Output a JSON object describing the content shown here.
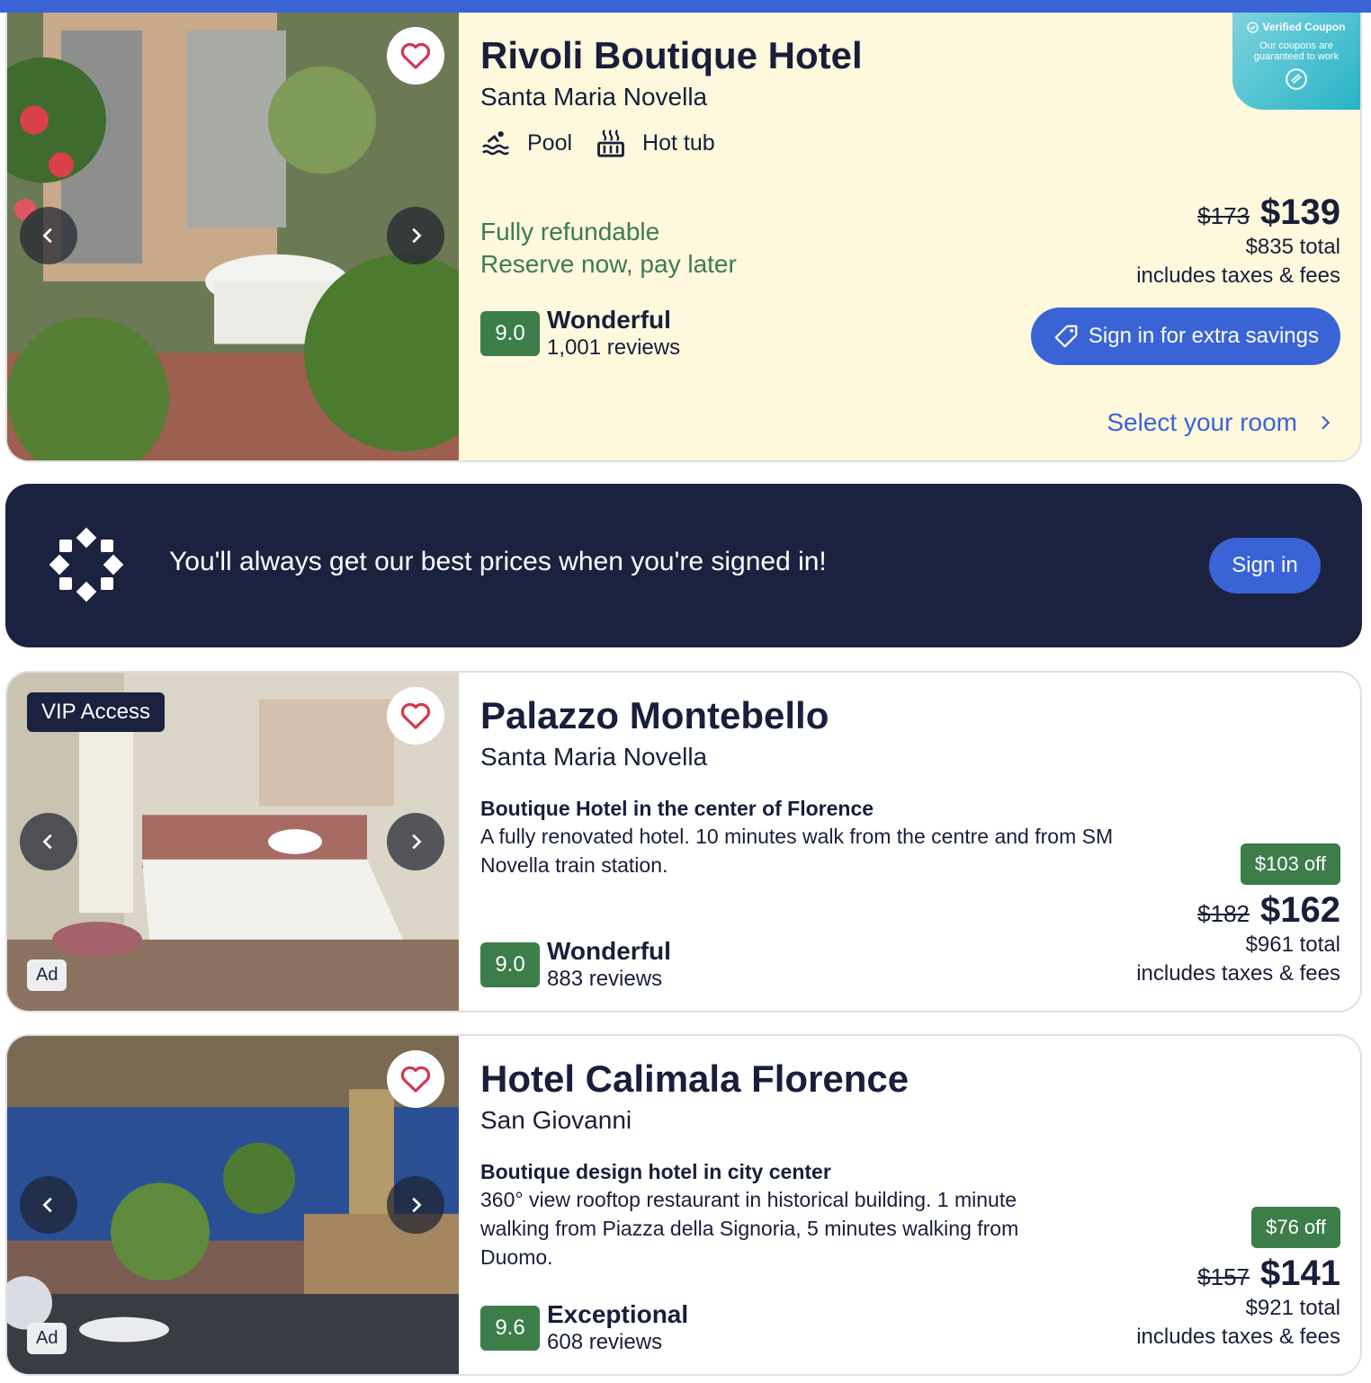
{
  "coupon": {
    "title": "Verified Coupon",
    "text": "Our coupons are guaranteed to work"
  },
  "banner": {
    "text": "You'll always get our best prices when you're signed in!",
    "button": "Sign in"
  },
  "hotels": [
    {
      "name": "Rivoli Boutique Hotel",
      "neighborhood": "Santa Maria Novella",
      "amenities": [
        "Pool",
        "Hot tub"
      ],
      "refundable": "Fully refundable",
      "pay_later": "Reserve now, pay later",
      "score": "9.0",
      "rating_label": "Wonderful",
      "reviews": "1,001 reviews",
      "old_price": "$173",
      "price": "$139",
      "total": "$835 total",
      "taxes": "includes taxes & fees",
      "sign_in_button": "Sign in for extra savings",
      "select_room": "Select your room"
    },
    {
      "name": "Palazzo Montebello",
      "neighborhood": "Santa Maria Novella",
      "badge": "VIP Access",
      "ad": "Ad",
      "desc_title": "Boutique Hotel in the center of Florence",
      "desc": "A fully renovated hotel. 10 minutes walk from the centre and from SM Novella train station.",
      "score": "9.0",
      "rating_label": "Wonderful",
      "reviews": "883 reviews",
      "discount": "$103 off",
      "old_price": "$182",
      "price": "$162",
      "total": "$961 total",
      "taxes": "includes taxes & fees"
    },
    {
      "name": "Hotel Calimala Florence",
      "neighborhood": "San Giovanni",
      "ad": "Ad",
      "desc_title": "Boutique design hotel in city center",
      "desc": "360° view rooftop restaurant in historical building. 1 minute walking from Piazza della Signoria, 5 minutes walking from Duomo.",
      "score": "9.6",
      "rating_label": "Exceptional",
      "reviews": "608 reviews",
      "discount": "$76 off",
      "old_price": "$157",
      "price": "$141",
      "total": "$921 total",
      "taxes": "includes taxes & fees"
    }
  ],
  "colors": {
    "brand_blue": "#3a64d6",
    "rating_green": "#3c7d4a",
    "navy": "#1b2240",
    "featured_bg": "#fef8dc"
  },
  "icons": [
    "heart-icon",
    "chevron-left-icon",
    "chevron-right-icon",
    "pool-icon",
    "hot-tub-icon",
    "tag-icon",
    "check-circle-icon",
    "loyalty-icon"
  ]
}
